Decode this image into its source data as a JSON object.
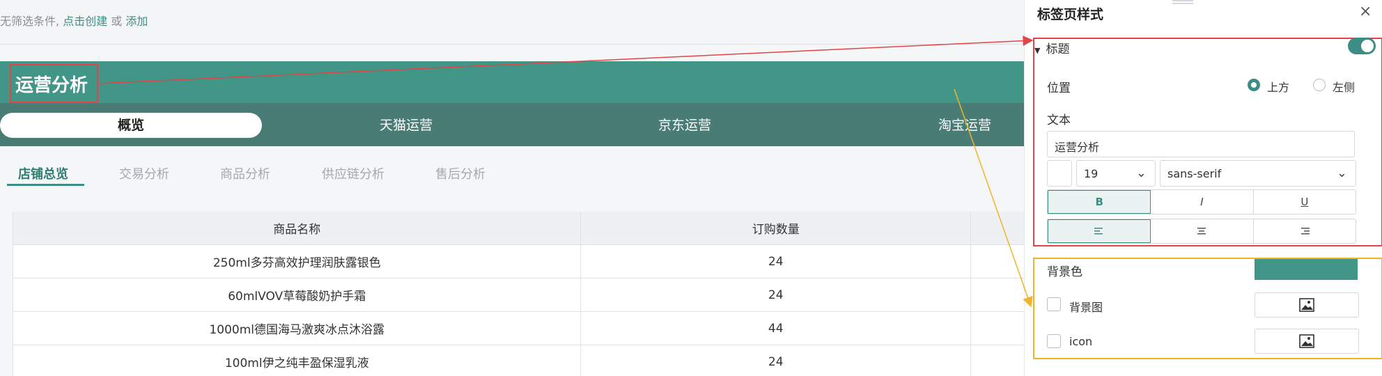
{
  "filter_bar": {
    "text": "无筛选条件,",
    "link_create": "点击创建",
    "or": "或",
    "link_add": "添加"
  },
  "title_band": {
    "title": "运营分析"
  },
  "tabs": [
    {
      "label": "概览"
    },
    {
      "label": "天猫运营"
    },
    {
      "label": "京东运营"
    },
    {
      "label": "淘宝运营"
    }
  ],
  "subtabs": [
    {
      "label": "店铺总览"
    },
    {
      "label": "交易分析"
    },
    {
      "label": "商品分析"
    },
    {
      "label": "供应链分析"
    },
    {
      "label": "售后分析"
    }
  ],
  "table": {
    "headers": [
      "商品名称",
      "订购数量"
    ],
    "rows": [
      [
        "250ml多芬高效护理润肤露银色",
        "24"
      ],
      [
        "60mlVOV草莓酸奶护手霜",
        "24"
      ],
      [
        "1000ml德国海马激爽冰点沐浴露",
        "44"
      ],
      [
        "100ml伊之纯丰盈保湿乳液",
        "24"
      ]
    ]
  },
  "panel": {
    "title": "标签页样式",
    "close": "×",
    "section_title": "标题",
    "position_label": "位置",
    "position_options": [
      "上方",
      "左侧"
    ],
    "text_label": "文本",
    "text_value": "运营分析",
    "font_size": "19",
    "font_family": "sans-serif",
    "style_buttons": [
      "B",
      "I",
      "U"
    ],
    "bg_color_label": "背景色",
    "bg_color": "#429688",
    "bg_image_label": "背景图",
    "icon_label": "icon"
  },
  "colors": {
    "accent": "#429688",
    "tab_strip": "#4a7c76",
    "red_frame": "#e24545",
    "yellow_frame": "#f0b429"
  }
}
